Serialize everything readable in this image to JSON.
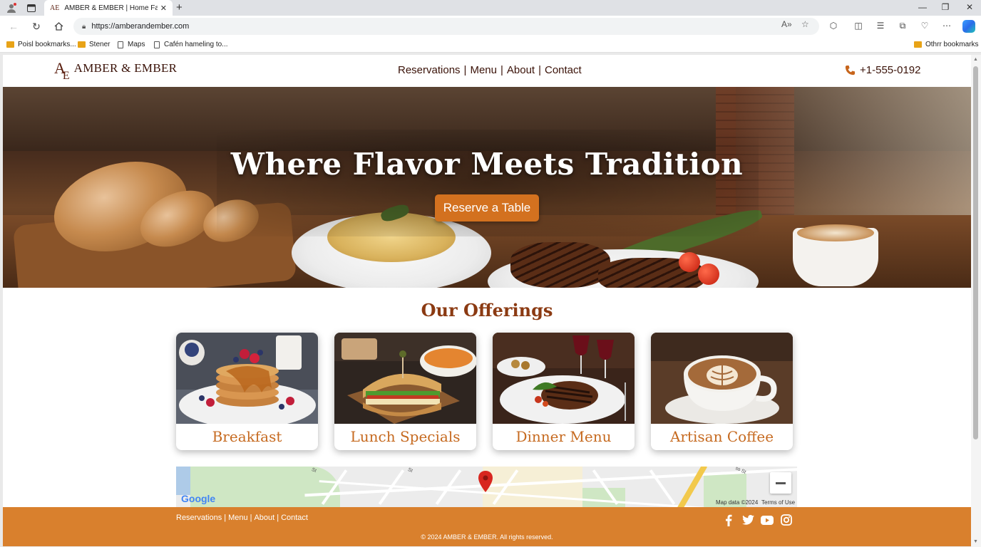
{
  "browser": {
    "tab_title": "AMBER & EMBER | Home Favor:",
    "tab_favicon": "AE",
    "url": "https://amberandember.com",
    "bookmarks": [
      {
        "label": "Poisl bookmarks...",
        "icon": "folder-icon"
      },
      {
        "label": "Stener",
        "icon": "folder-icon"
      },
      {
        "label": "Maps",
        "icon": "page-icon"
      },
      {
        "label": "Cafén hameling to...",
        "icon": "page-icon"
      }
    ],
    "other_bookmarks": "Othrr bookmarks"
  },
  "site": {
    "brand": "AMBER & EMBER",
    "logo_mark_a": "A",
    "logo_mark_e": "E",
    "nav": [
      "Reservations",
      "Menu",
      "About",
      "Contact"
    ],
    "nav_separator": "|",
    "phone": "+1-555-0192",
    "accent_color": "#d3711f",
    "brand_color": "#3a1208"
  },
  "hero": {
    "title": "Where Flavor Meets Tradition",
    "cta": "Reserve a Table"
  },
  "offerings": {
    "title": "Our Offerings",
    "cards": [
      {
        "label": "Breakfast"
      },
      {
        "label": "Lunch Specials"
      },
      {
        "label": "Dinner Menu"
      },
      {
        "label": "Artisan Coffee"
      }
    ]
  },
  "map": {
    "provider_logo": "Google",
    "map_data": "Map data ©2024",
    "terms": "Terms of Use",
    "street_labels": [
      "St",
      "St",
      "ss St"
    ]
  },
  "footer": {
    "nav": [
      "Reservations",
      "Menu",
      "About",
      "Contact"
    ],
    "separator": "|",
    "social": [
      "facebook-icon",
      "twitter-icon",
      "youtube-icon",
      "instagram-icon"
    ],
    "copyright": "© 2024 AMBER & EMBER. All rights reserved."
  }
}
